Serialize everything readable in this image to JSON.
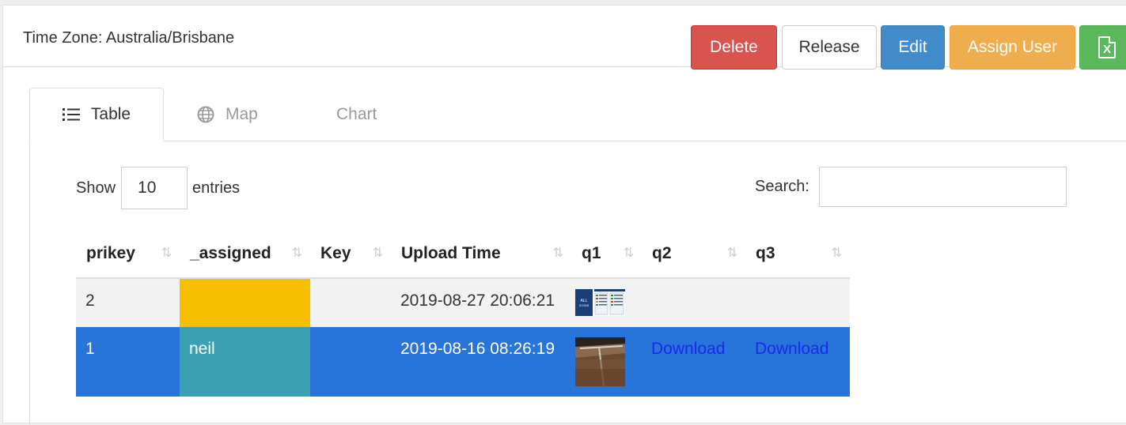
{
  "header": {
    "timezone": "Time Zone: Australia/Brisbane",
    "buttons": {
      "delete": "Delete",
      "release": "Release",
      "edit": "Edit",
      "assign_user": "Assign User",
      "excel_icon": "excel-file-icon",
      "excel_letter": "X"
    }
  },
  "tabs": [
    {
      "label": "Table",
      "icon": "list-icon",
      "active": true
    },
    {
      "label": "Map",
      "icon": "globe-icon",
      "active": false
    },
    {
      "label": "Chart",
      "icon": "",
      "active": false
    }
  ],
  "datatable": {
    "show_label": "Show",
    "page_length": "10",
    "entries_label": "entries",
    "search_label": "Search:",
    "search_value": "",
    "columns": [
      "prikey",
      "_assigned",
      "Key",
      "Upload Time",
      "q1",
      "q2",
      "q3"
    ],
    "rows": [
      {
        "prikey": "2",
        "assigned": "",
        "assigned_color": "#f7bf00",
        "key": "",
        "upload_time": "2019-08-27 20:06:21",
        "q1_thumbnail": "image-thumbnail",
        "q2": "",
        "q3": ""
      },
      {
        "prikey": "1",
        "assigned": "neil",
        "assigned_color": "#3aa0b4",
        "key": "",
        "upload_time": "2019-08-16 08:26:19",
        "q1_thumbnail": "image-thumbnail",
        "q2": "Download",
        "q3": "Download"
      }
    ]
  },
  "colors": {
    "delete": "#d9534f",
    "edit": "#428bca",
    "assign": "#f0ad4e",
    "excel": "#5cb85c",
    "selected_row": "#2874d9",
    "link": "#1a28ee"
  }
}
